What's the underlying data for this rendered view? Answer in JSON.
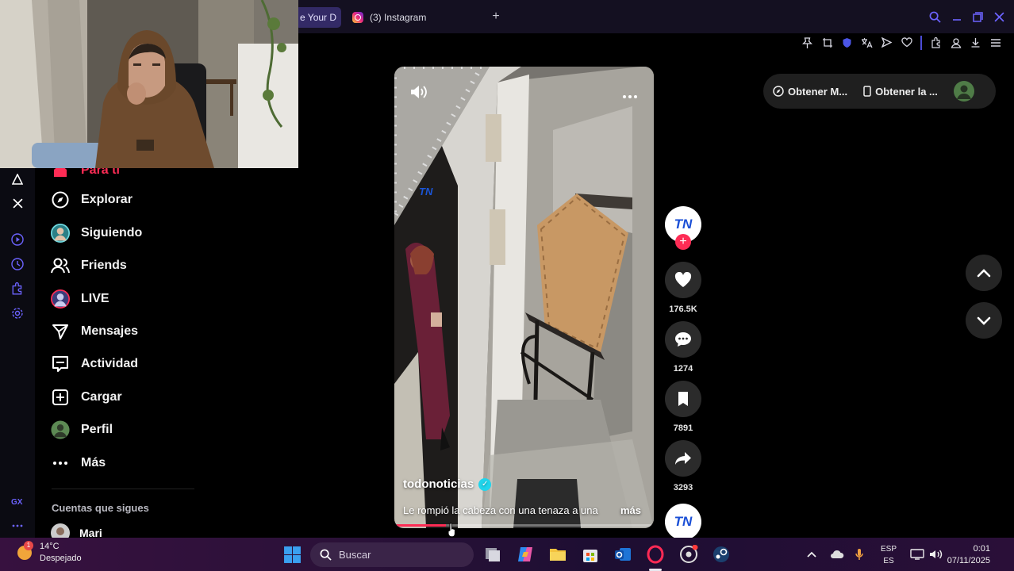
{
  "browser": {
    "tabs": [
      {
        "label": "e Your D"
      },
      {
        "label": "(3) Instagram"
      }
    ],
    "new_tab": "+"
  },
  "sidebar_nav": {
    "items": [
      {
        "label": "Para ti",
        "icon": "home-icon"
      },
      {
        "label": "Explorar",
        "icon": "compass-icon"
      },
      {
        "label": "Siguiendo",
        "icon": "avatar"
      },
      {
        "label": "Friends",
        "icon": "friends-icon"
      },
      {
        "label": "LIVE",
        "icon": "live-avatar"
      },
      {
        "label": "Mensajes",
        "icon": "send-icon"
      },
      {
        "label": "Actividad",
        "icon": "activity-icon"
      },
      {
        "label": "Cargar",
        "icon": "upload-icon"
      },
      {
        "label": "Perfil",
        "icon": "avatar"
      },
      {
        "label": "Más",
        "icon": "more-icon"
      }
    ],
    "following_heading": "Cuentas que sigues",
    "following": [
      {
        "name": "Mari"
      }
    ]
  },
  "video": {
    "username": "todonoticias",
    "caption": "Le rompió la cabeza con una tenaza a una",
    "more_label": "más",
    "watermark": "TN",
    "progress": 0.2
  },
  "actions": {
    "author_avatar": "TN",
    "follow_symbol": "+",
    "likes": "176.5K",
    "comments": "1274",
    "saves": "7891",
    "shares": "3293"
  },
  "top_right": {
    "get_app_1": "Obtener M...",
    "get_app_2": "Obtener la ..."
  },
  "taskbar": {
    "temperature": "14°C",
    "weather": "Despejado",
    "weather_badge": "1",
    "search_placeholder": "Buscar",
    "lang_top": "ESP",
    "lang_bottom": "ES",
    "time": "0:01",
    "date": "07/11/2025"
  }
}
